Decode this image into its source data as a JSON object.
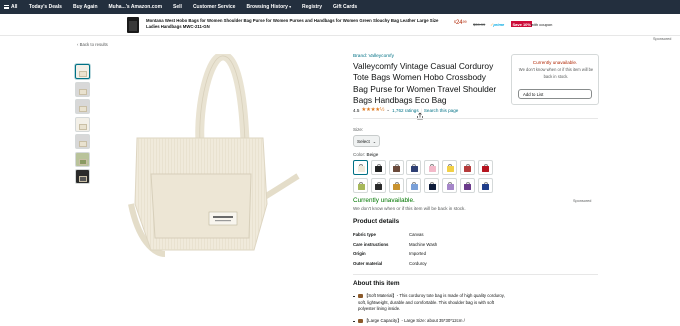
{
  "nav": {
    "all": "All",
    "items": [
      "Today's Deals",
      "Buy Again",
      "Muha...",
      "'s Amazon.com",
      "Sell",
      "Customer Service",
      "Browsing History",
      "Registry",
      "Gift Cards"
    ]
  },
  "ad": {
    "title": "Montana West Hobo Bags for Women Shoulder Bag Purse for Women Purses and Handbags for Women Green Slouchy Bag Leather Large Size Ladies Handbags MWC-211-GN",
    "price_symbol": "$",
    "price_whole": "24",
    "price_fraction": "99",
    "was_price": "$39.99",
    "prime": "prime",
    "save_badge": "Save 10%",
    "coupon": "with coupon"
  },
  "sponsored_top": "Sponsored",
  "back_link": "‹ Back to results",
  "product": {
    "brand": "Brand: Valleycomfy",
    "title": "Valleycomfy Vintage Casual Corduroy Tote Bags Women Hobo Crossbody Bag Purse for Women Travel Shoulder Bags Handbags Eco Bag",
    "rating_value": "4.5",
    "stars": "★★★★½",
    "chevron": "⌄",
    "ratings_count": "1,762 ratings",
    "separator": "|",
    "search_page": "Search this page",
    "size_label": "Size:",
    "size_value": "Select",
    "color_label": "Color:",
    "color_value": "Beige",
    "unavailable": "Currently unavailable.",
    "unavailable_sub": "We don't know when or if this item will be back in stock.",
    "sponsored": "Sponsored"
  },
  "swatch_colors": [
    "#f1ebdc",
    "#222222",
    "#6b4a3a",
    "#2e3f73",
    "#f3b9c9",
    "#f2d046",
    "#b53b3b",
    "#b5141f",
    "#a7b85a",
    "#2b2b2b",
    "#c8922e",
    "#7aa0d8",
    "#0d1b3a",
    "#a586c9",
    "#6a3a8a",
    "#1f3d8a"
  ],
  "details": {
    "heading": "Product details",
    "rows": [
      {
        "k": "Fabric type",
        "v": "Canvas"
      },
      {
        "k": "Care instructions",
        "v": "Machine Wash"
      },
      {
        "k": "Origin",
        "v": "Imported"
      },
      {
        "k": "Outer material",
        "v": "Corduroy"
      }
    ]
  },
  "about": {
    "heading": "About this item",
    "bullets": [
      "【Soft Material】- This corduroy tote bag is made of high quality corduroy, soft, lightweight, durable and comfortable. This shoulder bag is with soft polyester lining inside.",
      "【Large Capacity】- Large Size: about 35*30*12cm /"
    ]
  },
  "buybox": {
    "unavailable": "Currently unavailable.",
    "sub": "We don't know when or if this item will be back in stock.",
    "add_to_list": "Add to List"
  }
}
